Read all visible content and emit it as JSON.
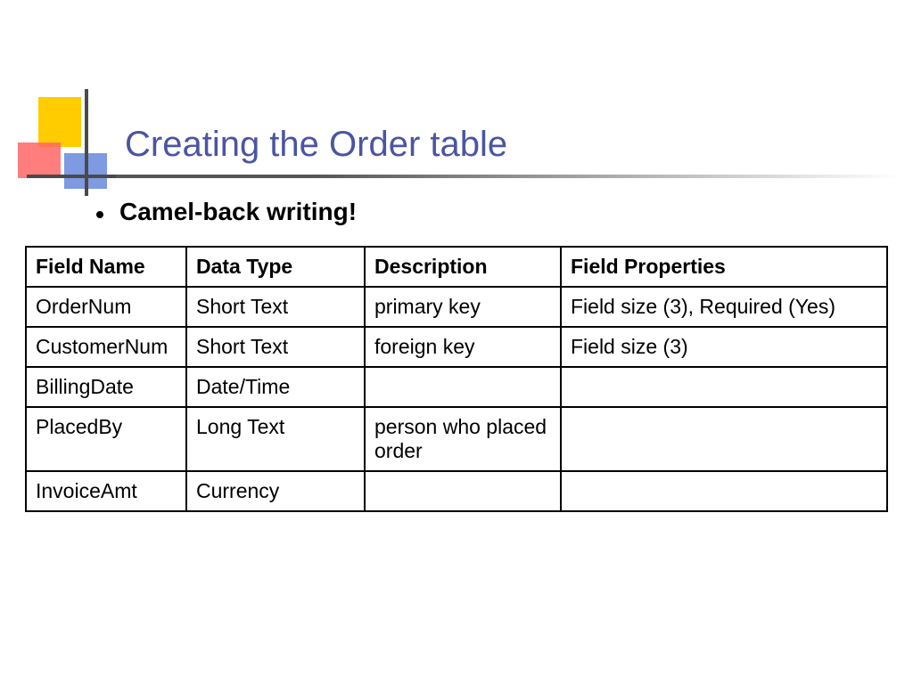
{
  "title": "Creating the Order table",
  "bullet": "Camel-back writing!",
  "table": {
    "headers": [
      "Field Name",
      "Data Type",
      "Description",
      "Field Properties"
    ],
    "rows": [
      {
        "field": "OrderNum",
        "type": "Short Text",
        "desc": "primary key",
        "props": "Field size (3), Required (Yes)"
      },
      {
        "field": "CustomerNum",
        "type": "Short Text",
        "desc": "foreign key",
        "props": "Field size (3)"
      },
      {
        "field": "BillingDate",
        "type": "Date/Time",
        "desc": "",
        "props": ""
      },
      {
        "field": "PlacedBy",
        "type": "Long Text",
        "desc": "person who placed order",
        "props": ""
      },
      {
        "field": "InvoiceAmt",
        "type": "Currency",
        "desc": "",
        "props": ""
      }
    ]
  }
}
